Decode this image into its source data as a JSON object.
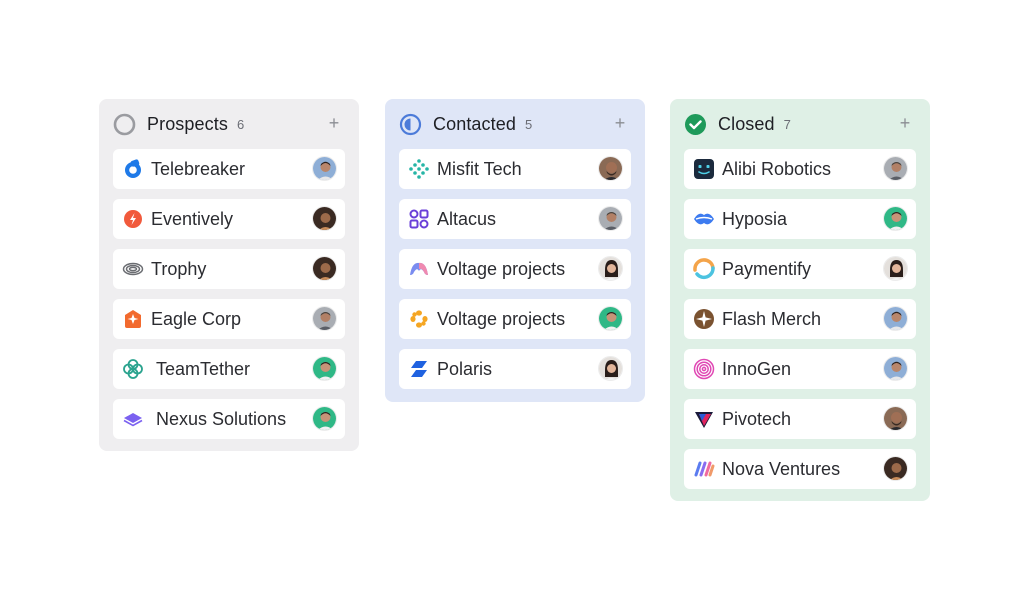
{
  "colors": {
    "prospects_bg": "#efeef0",
    "contacted_bg": "#dfe6f7",
    "closed_bg": "#dff0e6",
    "card_bg": "#ffffff",
    "contacted_icon": "#4c7bd9",
    "closed_icon": "#1e9a5a"
  },
  "columns": [
    {
      "title": "Prospects",
      "count": "6",
      "status_icon": "empty-circle-icon",
      "add_label": "+",
      "cards": [
        {
          "name": "Telebreaker",
          "logo": "telebreaker-logo",
          "avatar": "avatar-man-glasses"
        },
        {
          "name": "Eventively",
          "logo": "eventively-logo",
          "avatar": "avatar-woman-dark"
        },
        {
          "name": "Trophy",
          "logo": "trophy-logo",
          "avatar": "avatar-woman-dark"
        },
        {
          "name": "Eagle Corp",
          "logo": "eagle-corp-logo",
          "avatar": "avatar-man-gray"
        },
        {
          "name": "TeamTether",
          "logo": "teamtether-logo",
          "avatar": "avatar-man-green"
        },
        {
          "name": "Nexus Solutions",
          "logo": "nexus-solutions-logo",
          "avatar": "avatar-man-green"
        }
      ]
    },
    {
      "title": "Contacted",
      "count": "5",
      "status_icon": "half-circle-icon",
      "add_label": "+",
      "cards": [
        {
          "name": "Misfit Tech",
          "logo": "misfit-tech-logo",
          "avatar": "avatar-man-bald"
        },
        {
          "name": "Altacus",
          "logo": "altacus-logo",
          "avatar": "avatar-man-gray"
        },
        {
          "name": "Voltage projects",
          "logo": "voltage-projects-logo",
          "avatar": "avatar-woman-light"
        },
        {
          "name": "Voltage projects",
          "logo": "voltage-projects-alt-logo",
          "avatar": "avatar-man-green"
        },
        {
          "name": "Polaris",
          "logo": "polaris-logo",
          "avatar": "avatar-woman-light"
        }
      ]
    },
    {
      "title": "Closed",
      "count": "7",
      "status_icon": "check-circle-icon",
      "add_label": "+",
      "cards": [
        {
          "name": "Alibi Robotics",
          "logo": "alibi-robotics-logo",
          "avatar": "avatar-man-gray"
        },
        {
          "name": "Hyposia",
          "logo": "hyposia-logo",
          "avatar": "avatar-man-green"
        },
        {
          "name": "Paymentify",
          "logo": "paymentify-logo",
          "avatar": "avatar-woman-light"
        },
        {
          "name": "Flash Merch",
          "logo": "flash-merch-logo",
          "avatar": "avatar-man-glasses"
        },
        {
          "name": "InnoGen",
          "logo": "innogen-logo",
          "avatar": "avatar-man-glasses"
        },
        {
          "name": "Pivotech",
          "logo": "pivotech-logo",
          "avatar": "avatar-man-bald"
        },
        {
          "name": "Nova Ventures",
          "logo": "nova-ventures-logo",
          "avatar": "avatar-woman-dark"
        }
      ]
    }
  ]
}
